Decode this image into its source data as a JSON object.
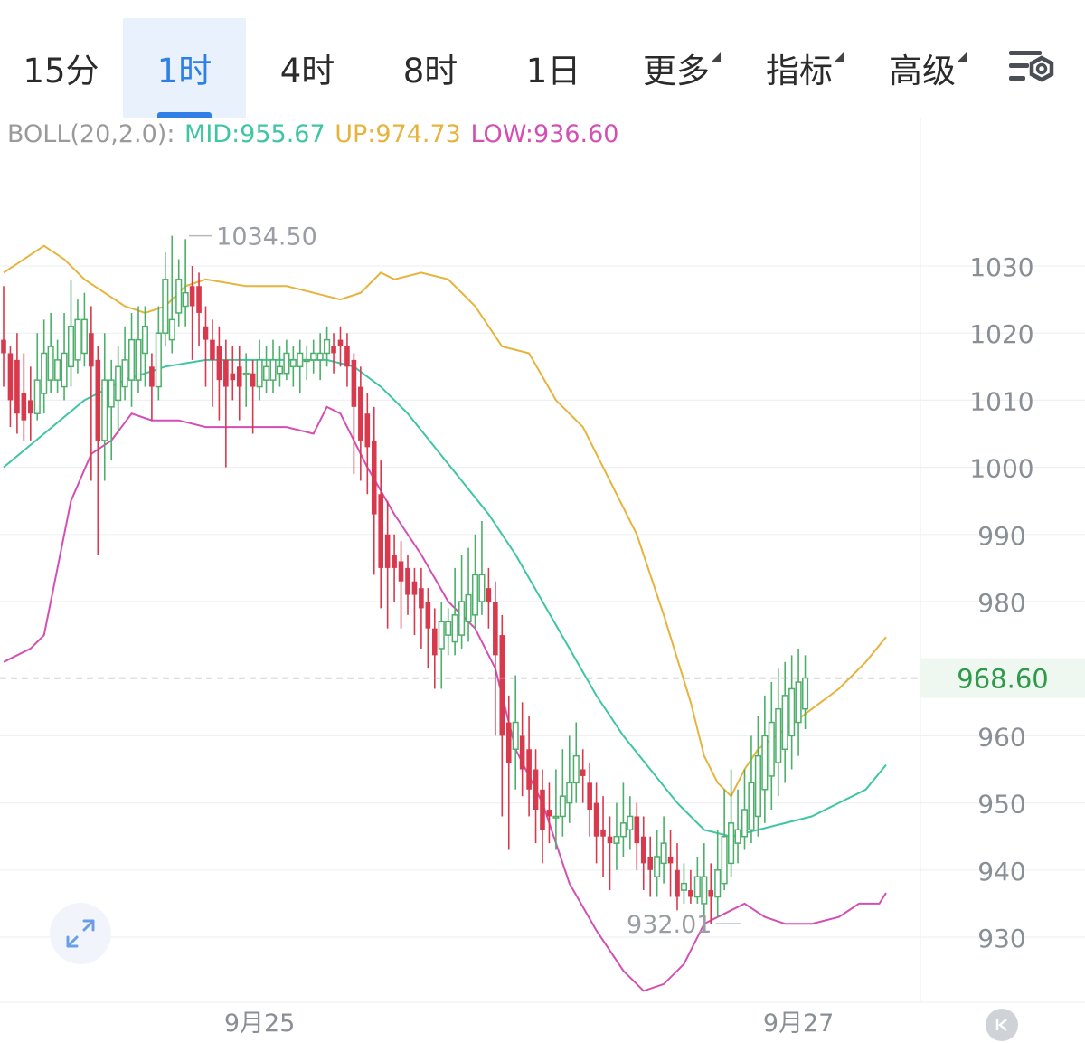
{
  "tabs": [
    {
      "label": "15分",
      "active": false,
      "dropdown": false
    },
    {
      "label": "1时",
      "active": true,
      "dropdown": false
    },
    {
      "label": "4时",
      "active": false,
      "dropdown": false
    },
    {
      "label": "8时",
      "active": false,
      "dropdown": false
    },
    {
      "label": "1日",
      "active": false,
      "dropdown": false
    },
    {
      "label": "更多",
      "active": false,
      "dropdown": true
    },
    {
      "label": "指标",
      "active": false,
      "dropdown": true
    },
    {
      "label": "高级",
      "active": false,
      "dropdown": true
    }
  ],
  "settings_icon": "chart-settings-gear-icon",
  "legend": {
    "prefix": "BOLL(20,2.0):",
    "mid": "MID:955.67",
    "up": "UP:974.73",
    "low": "LOW:936.60"
  },
  "colors": {
    "up_candle": "#4caf6a",
    "down_candle": "#d9394d",
    "mid": "#3ec6a4",
    "upper": "#e6b43c",
    "lower": "#d44fb4",
    "price_label": "#2e9a4a",
    "legend_prefix": "#9a9a9a",
    "active_tab": "#2f7fe6"
  },
  "chart_data": {
    "type": "candlestick",
    "indicator": "BOLL(20,2.0)",
    "ylim": [
      922,
      1047
    ],
    "y_ticks": [
      1030,
      1020,
      1010,
      1000,
      990,
      980,
      960,
      950,
      940,
      930
    ],
    "x_ticks": [
      {
        "label": "9月25",
        "index": 38
      },
      {
        "label": "9月27",
        "index": 118
      }
    ],
    "current_price": "968.60",
    "current_price_value": 968.6,
    "high_marker": {
      "label": "1034.50",
      "value": 1034.5,
      "index": 27
    },
    "low_marker": {
      "label": "932.01",
      "value": 932.01,
      "index": 110
    },
    "candles": [
      [
        1019,
        1017,
        1027,
        1012
      ],
      [
        1017,
        1010,
        1018,
        1006
      ],
      [
        1016,
        1008,
        1020,
        1005
      ],
      [
        1011,
        1007,
        1017,
        1004
      ],
      [
        1010,
        1008,
        1015,
        1004
      ],
      [
        1008,
        1013,
        1020,
        1007
      ],
      [
        1011,
        1017,
        1022,
        1008
      ],
      [
        1013,
        1018,
        1023,
        1011
      ],
      [
        1013,
        1016,
        1019,
        1011
      ],
      [
        1012,
        1017,
        1023,
        1010
      ],
      [
        1015,
        1021,
        1028,
        1012
      ],
      [
        1016,
        1022,
        1025,
        1014
      ],
      [
        1017,
        1022,
        1026,
        1015
      ],
      [
        1020,
        1015,
        1024,
        998
      ],
      [
        1016,
        1004,
        1018,
        987
      ],
      [
        1004,
        1013,
        1020,
        998
      ],
      [
        1009,
        1013,
        1016,
        1001
      ],
      [
        1010,
        1015,
        1018,
        1005
      ],
      [
        1012,
        1016,
        1021,
        1010
      ],
      [
        1013,
        1019,
        1023,
        1009
      ],
      [
        1013,
        1019,
        1024,
        1011
      ],
      [
        1017,
        1021,
        1024,
        1012
      ],
      [
        1015,
        1012,
        1017,
        1007
      ],
      [
        1012,
        1020,
        1024,
        1010
      ],
      [
        1020,
        1028,
        1032,
        1018
      ],
      [
        1019,
        1022,
        1034.5,
        1017
      ],
      [
        1023,
        1028,
        1031,
        1021
      ],
      [
        1024,
        1026,
        1034,
        1021
      ],
      [
        1027,
        1024,
        1030,
        1016
      ],
      [
        1027,
        1023,
        1029,
        1018
      ],
      [
        1021,
        1019,
        1024,
        1012
      ],
      [
        1019,
        1016,
        1022,
        1009
      ],
      [
        1018,
        1013,
        1021,
        1007
      ],
      [
        1016,
        1012,
        1019,
        1000
      ],
      [
        1014,
        1013,
        1018,
        1010
      ],
      [
        1015,
        1012,
        1018,
        1007
      ],
      [
        1014,
        1014,
        1017,
        1009
      ],
      [
        1014,
        1012,
        1016,
        1005
      ],
      [
        1012,
        1016,
        1019,
        1010
      ],
      [
        1013,
        1015,
        1018,
        1011
      ],
      [
        1013,
        1016,
        1019,
        1011
      ],
      [
        1014,
        1015,
        1018,
        1012
      ],
      [
        1014,
        1017,
        1019,
        1013
      ],
      [
        1015,
        1016,
        1018,
        1012
      ],
      [
        1015,
        1017,
        1019,
        1011
      ],
      [
        1016,
        1016,
        1018,
        1013
      ],
      [
        1016,
        1017,
        1019,
        1014
      ],
      [
        1016,
        1017,
        1020,
        1013
      ],
      [
        1017,
        1019,
        1021,
        1015
      ],
      [
        1018,
        1017,
        1020,
        1014
      ],
      [
        1019,
        1018,
        1021,
        1015
      ],
      [
        1018,
        1015,
        1020,
        1012
      ],
      [
        1016,
        1009,
        1017,
        999
      ],
      [
        1012,
        1004,
        1015,
        998
      ],
      [
        1008,
        1003,
        1011,
        996
      ],
      [
        1004,
        993,
        1009,
        984
      ],
      [
        996,
        985,
        1001,
        979
      ],
      [
        990,
        985,
        995,
        976
      ],
      [
        987,
        985,
        990,
        980
      ],
      [
        986,
        983,
        989,
        976
      ],
      [
        985,
        981,
        987,
        978
      ],
      [
        983,
        981,
        985,
        975
      ],
      [
        982,
        979,
        985,
        973
      ],
      [
        980,
        976,
        982,
        970
      ],
      [
        976,
        972,
        979,
        967
      ],
      [
        973,
        977,
        980,
        967
      ],
      [
        975,
        977,
        979,
        972
      ],
      [
        974,
        978,
        985,
        972
      ],
      [
        975,
        980,
        987,
        973
      ],
      [
        977,
        981,
        988,
        974
      ],
      [
        978,
        984,
        990,
        976
      ],
      [
        980,
        984,
        992,
        978
      ],
      [
        982,
        980,
        985,
        976
      ],
      [
        980,
        972,
        983,
        960
      ],
      [
        975,
        960,
        978,
        948
      ],
      [
        962,
        956,
        966,
        943
      ],
      [
        958,
        962,
        969,
        952
      ],
      [
        960,
        955,
        965,
        951
      ],
      [
        958,
        952,
        963,
        948
      ],
      [
        955,
        949,
        958,
        944
      ],
      [
        952,
        946,
        955,
        941
      ],
      [
        949,
        948,
        953,
        944
      ],
      [
        948,
        948,
        955,
        943
      ],
      [
        948,
        951,
        958,
        945
      ],
      [
        950,
        953,
        960,
        947
      ],
      [
        953,
        957,
        962,
        950
      ],
      [
        955,
        954,
        958,
        950
      ],
      [
        953,
        949,
        956,
        945
      ],
      [
        950,
        945,
        953,
        941
      ],
      [
        946,
        945,
        951,
        939
      ],
      [
        945,
        944,
        948,
        937
      ],
      [
        944,
        945,
        950,
        940
      ],
      [
        945,
        947,
        953,
        942
      ],
      [
        946,
        948,
        951,
        943
      ],
      [
        948,
        944,
        950,
        940
      ],
      [
        945,
        941,
        948,
        937
      ],
      [
        942,
        940,
        945,
        936
      ],
      [
        939,
        942,
        946,
        936
      ],
      [
        941,
        944,
        948,
        938
      ],
      [
        942,
        941,
        946,
        936
      ],
      [
        940,
        936,
        944,
        934
      ],
      [
        937,
        938,
        941,
        935
      ],
      [
        937,
        936,
        940,
        935
      ],
      [
        936,
        939,
        942,
        935
      ],
      [
        935,
        939,
        944,
        933
      ],
      [
        937,
        936,
        941,
        932.01
      ],
      [
        936,
        940,
        946,
        933
      ],
      [
        938,
        945,
        952,
        937
      ],
      [
        941,
        947,
        955,
        939
      ],
      [
        944,
        946,
        952,
        941
      ],
      [
        945,
        949,
        955,
        943
      ],
      [
        946,
        953,
        960,
        944
      ],
      [
        948,
        957,
        963,
        945
      ],
      [
        952,
        960,
        966,
        947
      ],
      [
        954,
        962,
        968,
        949
      ],
      [
        956,
        964,
        970,
        951
      ],
      [
        958,
        966,
        971,
        953
      ],
      [
        960,
        967,
        972,
        955
      ],
      [
        962,
        968,
        973,
        957
      ],
      [
        964,
        968.6,
        972,
        961
      ]
    ],
    "mid_series": [
      {
        "index": 0,
        "value": 1000
      },
      {
        "index": 6,
        "value": 1005
      },
      {
        "index": 12,
        "value": 1010
      },
      {
        "index": 18,
        "value": 1013
      },
      {
        "index": 24,
        "value": 1015
      },
      {
        "index": 30,
        "value": 1016
      },
      {
        "index": 36,
        "value": 1016
      },
      {
        "index": 42,
        "value": 1016
      },
      {
        "index": 48,
        "value": 1016
      },
      {
        "index": 52,
        "value": 1015
      },
      {
        "index": 56,
        "value": 1012
      },
      {
        "index": 60,
        "value": 1008
      },
      {
        "index": 64,
        "value": 1003
      },
      {
        "index": 68,
        "value": 998
      },
      {
        "index": 72,
        "value": 993
      },
      {
        "index": 76,
        "value": 987
      },
      {
        "index": 80,
        "value": 980
      },
      {
        "index": 84,
        "value": 973
      },
      {
        "index": 88,
        "value": 966
      },
      {
        "index": 92,
        "value": 960
      },
      {
        "index": 96,
        "value": 955
      },
      {
        "index": 100,
        "value": 950
      },
      {
        "index": 104,
        "value": 946
      },
      {
        "index": 108,
        "value": 945
      },
      {
        "index": 112,
        "value": 946
      },
      {
        "index": 116,
        "value": 947
      },
      {
        "index": 120,
        "value": 948
      },
      {
        "index": 124,
        "value": 950
      },
      {
        "index": 128,
        "value": 952
      },
      {
        "index": 131,
        "value": 955.67
      }
    ],
    "upper_series": [
      {
        "index": 0,
        "value": 1029
      },
      {
        "index": 3,
        "value": 1031
      },
      {
        "index": 6,
        "value": 1033
      },
      {
        "index": 9,
        "value": 1031
      },
      {
        "index": 12,
        "value": 1028
      },
      {
        "index": 15,
        "value": 1026
      },
      {
        "index": 18,
        "value": 1024
      },
      {
        "index": 21,
        "value": 1023
      },
      {
        "index": 24,
        "value": 1024
      },
      {
        "index": 27,
        "value": 1027
      },
      {
        "index": 30,
        "value": 1028
      },
      {
        "index": 36,
        "value": 1027
      },
      {
        "index": 42,
        "value": 1027
      },
      {
        "index": 46,
        "value": 1026
      },
      {
        "index": 50,
        "value": 1025
      },
      {
        "index": 53,
        "value": 1026
      },
      {
        "index": 56,
        "value": 1029
      },
      {
        "index": 58,
        "value": 1028
      },
      {
        "index": 62,
        "value": 1029
      },
      {
        "index": 66,
        "value": 1028
      },
      {
        "index": 70,
        "value": 1024
      },
      {
        "index": 74,
        "value": 1018
      },
      {
        "index": 78,
        "value": 1017
      },
      {
        "index": 82,
        "value": 1010
      },
      {
        "index": 86,
        "value": 1006
      },
      {
        "index": 90,
        "value": 998
      },
      {
        "index": 94,
        "value": 990
      },
      {
        "index": 98,
        "value": 978
      },
      {
        "index": 102,
        "value": 965
      },
      {
        "index": 104,
        "value": 957
      },
      {
        "index": 106,
        "value": 953
      },
      {
        "index": 108,
        "value": 951
      },
      {
        "index": 110,
        "value": 955
      },
      {
        "index": 112,
        "value": 958
      },
      {
        "index": 116,
        "value": 961
      },
      {
        "index": 120,
        "value": 964
      },
      {
        "index": 124,
        "value": 967
      },
      {
        "index": 128,
        "value": 971
      },
      {
        "index": 131,
        "value": 974.73
      }
    ],
    "lower_series": [
      {
        "index": 0,
        "value": 971
      },
      {
        "index": 4,
        "value": 973
      },
      {
        "index": 6,
        "value": 975
      },
      {
        "index": 8,
        "value": 985
      },
      {
        "index": 10,
        "value": 995
      },
      {
        "index": 13,
        "value": 1002
      },
      {
        "index": 16,
        "value": 1004
      },
      {
        "index": 19,
        "value": 1008
      },
      {
        "index": 22,
        "value": 1007
      },
      {
        "index": 26,
        "value": 1007
      },
      {
        "index": 30,
        "value": 1006
      },
      {
        "index": 36,
        "value": 1006
      },
      {
        "index": 42,
        "value": 1006
      },
      {
        "index": 46,
        "value": 1005
      },
      {
        "index": 48,
        "value": 1009
      },
      {
        "index": 50,
        "value": 1008
      },
      {
        "index": 54,
        "value": 1000
      },
      {
        "index": 58,
        "value": 993
      },
      {
        "index": 62,
        "value": 987
      },
      {
        "index": 66,
        "value": 980
      },
      {
        "index": 70,
        "value": 976
      },
      {
        "index": 73,
        "value": 970
      },
      {
        "index": 76,
        "value": 958
      },
      {
        "index": 80,
        "value": 950
      },
      {
        "index": 84,
        "value": 938
      },
      {
        "index": 88,
        "value": 931
      },
      {
        "index": 92,
        "value": 925
      },
      {
        "index": 95,
        "value": 922
      },
      {
        "index": 98,
        "value": 923
      },
      {
        "index": 101,
        "value": 926
      },
      {
        "index": 104,
        "value": 932
      },
      {
        "index": 108,
        "value": 934
      },
      {
        "index": 110,
        "value": 935
      },
      {
        "index": 113,
        "value": 933
      },
      {
        "index": 116,
        "value": 932
      },
      {
        "index": 120,
        "value": 932
      },
      {
        "index": 124,
        "value": 933
      },
      {
        "index": 127,
        "value": 935
      },
      {
        "index": 130,
        "value": 935
      },
      {
        "index": 131,
        "value": 936.6
      }
    ]
  }
}
